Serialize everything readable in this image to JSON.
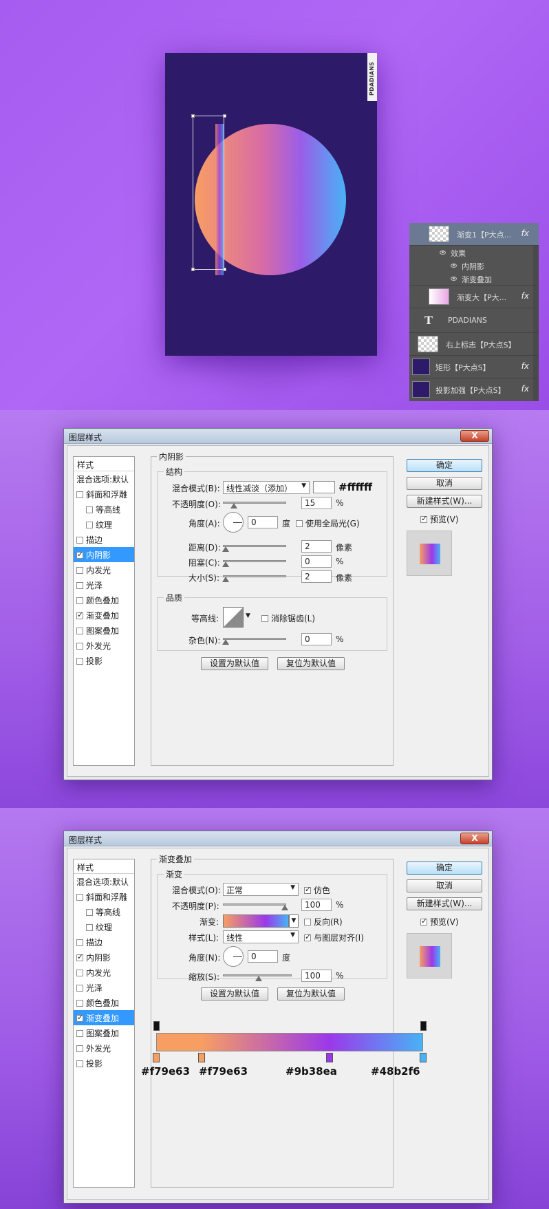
{
  "poster": {
    "brand_text": "PDADIANS"
  },
  "layers_panel": {
    "rows": [
      {
        "name": "渐变1【P大点...",
        "fx": "fx"
      },
      {
        "name": "效果"
      },
      {
        "name": "内阴影"
      },
      {
        "name": "渐变叠加"
      },
      {
        "name": "渐变大【P大...",
        "fx": "fx"
      },
      {
        "name": "PDADIANS"
      },
      {
        "name": "右上标志【P大点S】"
      },
      {
        "name": "矩形【P大点S】",
        "fx": "fx"
      },
      {
        "name": "投影加强【P大点S】",
        "fx": "fx"
      }
    ]
  },
  "dialog_inner_shadow": {
    "title": "图层样式",
    "close": "X",
    "styles_header": "样式",
    "blend_options": "混合选项:默认",
    "style_items": [
      {
        "label": "斜面和浮雕",
        "checked": false,
        "indent": false
      },
      {
        "label": "等高线",
        "checked": false,
        "indent": true
      },
      {
        "label": "纹理",
        "checked": false,
        "indent": true
      },
      {
        "label": "描边",
        "checked": false,
        "indent": false
      },
      {
        "label": "内阴影",
        "checked": true,
        "indent": false,
        "active": true
      },
      {
        "label": "内发光",
        "checked": false,
        "indent": false
      },
      {
        "label": "光泽",
        "checked": false,
        "indent": false
      },
      {
        "label": "颜色叠加",
        "checked": false,
        "indent": false
      },
      {
        "label": "渐变叠加",
        "checked": true,
        "indent": false
      },
      {
        "label": "图案叠加",
        "checked": false,
        "indent": false
      },
      {
        "label": "外发光",
        "checked": false,
        "indent": false
      },
      {
        "label": "投影",
        "checked": false,
        "indent": false
      }
    ],
    "section_title": "内阴影",
    "structure_title": "结构",
    "blend_mode_label": "混合模式(B):",
    "blend_mode_value": "线性减淡（添加）",
    "color_hex": "#ffffff",
    "opacity_label": "不透明度(O):",
    "opacity_value": "15",
    "percent": "%",
    "angle_label": "角度(A):",
    "angle_value": "0",
    "degree": "度",
    "global_light_label": "使用全局光(G)",
    "distance_label": "距离(D):",
    "distance_value": "2",
    "choke_label": "阻塞(C):",
    "choke_value": "0",
    "size_label": "大小(S):",
    "size_value": "2",
    "pixels": "像素",
    "quality_title": "品质",
    "contour_label": "等高线:",
    "antialias_label": "消除锯齿(L)",
    "noise_label": "杂色(N):",
    "noise_value": "0",
    "set_default": "设置为默认值",
    "reset_default": "复位为默认值",
    "ok": "确定",
    "cancel": "取消",
    "new_style": "新建样式(W)...",
    "preview_label": "预览(V)"
  },
  "dialog_gradient_overlay": {
    "title": "图层样式",
    "close": "X",
    "styles_header": "样式",
    "blend_options": "混合选项:默认",
    "style_items": [
      {
        "label": "斜面和浮雕",
        "checked": false,
        "indent": false
      },
      {
        "label": "等高线",
        "checked": false,
        "indent": true
      },
      {
        "label": "纹理",
        "checked": false,
        "indent": true
      },
      {
        "label": "描边",
        "checked": false,
        "indent": false
      },
      {
        "label": "内阴影",
        "checked": true,
        "indent": false
      },
      {
        "label": "内发光",
        "checked": false,
        "indent": false
      },
      {
        "label": "光泽",
        "checked": false,
        "indent": false
      },
      {
        "label": "颜色叠加",
        "checked": false,
        "indent": false
      },
      {
        "label": "渐变叠加",
        "checked": true,
        "indent": false,
        "active": true
      },
      {
        "label": "图案叠加",
        "checked": false,
        "indent": false
      },
      {
        "label": "外发光",
        "checked": false,
        "indent": false
      },
      {
        "label": "投影",
        "checked": false,
        "indent": false
      }
    ],
    "section_title": "渐变叠加",
    "gradient_title": "渐变",
    "blend_mode_label": "混合模式(O):",
    "blend_mode_value": "正常",
    "dither_label": "仿色",
    "opacity_label": "不透明度(P):",
    "opacity_value": "100",
    "percent": "%",
    "gradient_label": "渐变:",
    "reverse_label": "反向(R)",
    "style_label": "样式(L):",
    "style_value": "线性",
    "align_label": "与图层对齐(I)",
    "angle_label": "角度(N):",
    "angle_value": "0",
    "degree": "度",
    "scale_label": "缩放(S):",
    "scale_value": "100",
    "set_default": "设置为默认值",
    "reset_default": "复位为默认值",
    "ok": "确定",
    "cancel": "取消",
    "new_style": "新建样式(W)...",
    "preview_label": "预览(V)",
    "gradient_stops": [
      {
        "hex": "#f79e63",
        "color": "#f79e63",
        "position": 0
      },
      {
        "hex": "#f79e63",
        "color": "#f79e63",
        "position": 17
      },
      {
        "hex": "#9b38ea",
        "color": "#9b38ea",
        "position": 65
      },
      {
        "hex": "#48b2f6",
        "color": "#48b2f6",
        "position": 100
      }
    ]
  }
}
